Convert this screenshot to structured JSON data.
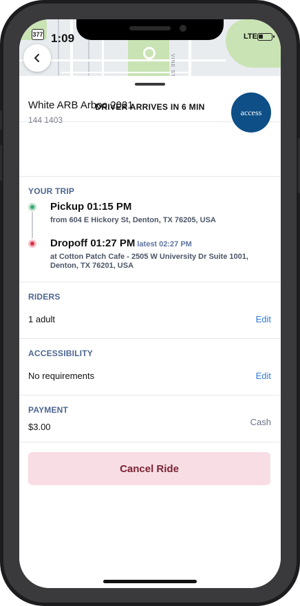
{
  "status_bar": {
    "time": "1:09",
    "route_badge": "377",
    "network": "LTE"
  },
  "sheet": {
    "header": "DRIVER ARRIVES IN 6 MIN",
    "vehicle": {
      "name": "White ARB Arboc 2021",
      "plate": "144 1403",
      "logo_text": "access"
    },
    "trip": {
      "heading": "YOUR TRIP",
      "pickup": {
        "title": "Pickup 01:15 PM",
        "address": "from 604 E Hickory St, Denton, TX 76205, USA"
      },
      "dropoff": {
        "title": "Dropoff 01:27 PM",
        "latest": "latest 02:27 PM",
        "address": "at Cotton Patch Cafe - 2505 W University Dr Suite 1001, Denton, TX 76201, USA"
      }
    },
    "riders": {
      "heading": "RIDERS",
      "value": "1 adult",
      "edit_label": "Edit"
    },
    "accessibility": {
      "heading": "ACCESSIBILITY",
      "value": "No requirements",
      "edit_label": "Edit"
    },
    "payment": {
      "heading": "PAYMENT",
      "amount": "$3.00",
      "method": "Cash"
    },
    "cancel_label": "Cancel Ride"
  },
  "map": {
    "street_label": "VINE ST"
  },
  "colors": {
    "accent_link": "#2e7bd6",
    "section_heading": "#4d6690",
    "pickup_dot": "#3aa876",
    "dropoff_dot": "#d6334a",
    "cancel_bg": "#f8dde4",
    "cancel_text": "#7a2233",
    "access_logo_bg": "#0d4f86"
  }
}
